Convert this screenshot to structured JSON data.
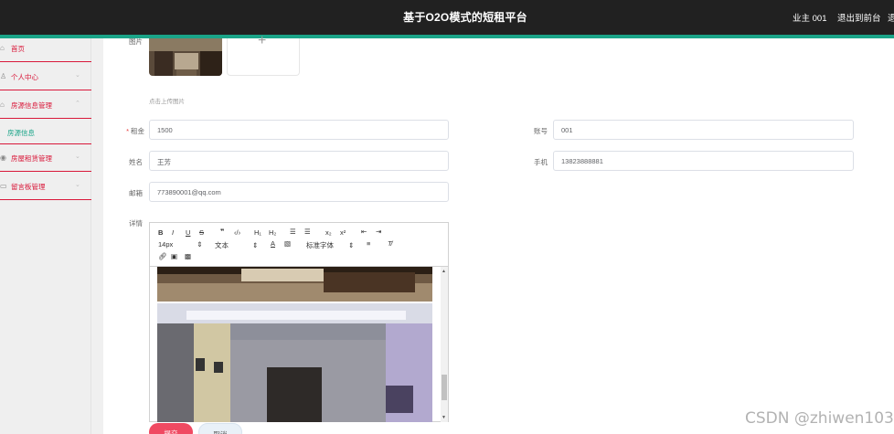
{
  "header": {
    "title": "基于O2O模式的短租平台",
    "user": "业主 001",
    "logout_front": "退出到前台",
    "logout_extra": "退"
  },
  "sidebar": {
    "items": [
      {
        "icon": "home-icon",
        "label": "首页"
      },
      {
        "icon": "user-icon",
        "label": "个人中心"
      },
      {
        "icon": "house-icon",
        "label": "房源信息管理"
      },
      {
        "icon": "pin-icon",
        "label": "房屋租赁管理"
      },
      {
        "icon": "comment-icon",
        "label": "留言板管理"
      }
    ],
    "sub_items": [
      {
        "label": "房源信息"
      }
    ]
  },
  "form": {
    "image_label": "图片",
    "upload_hint": "点击上传图片",
    "rent_label": "租金",
    "rent_value": "1500",
    "account_label": "账号",
    "account_value": "001",
    "name_label": "姓名",
    "name_value": "王芳",
    "phone_label": "手机",
    "phone_value": "13823888881",
    "email_label": "邮箱",
    "email_value": "773890001@qq.com",
    "detail_label": "详情"
  },
  "editor": {
    "font_size": "14px",
    "text_style": "文本",
    "font_family": "标准字体"
  },
  "buttons": {
    "submit": "提交",
    "cancel": "取消"
  },
  "watermark": "CSDN @zhiwen103",
  "colors": {
    "header_bg": "#212121",
    "accent": "#1aa488",
    "menu_text": "#d9183a",
    "submit_bg": "#f04a62"
  }
}
